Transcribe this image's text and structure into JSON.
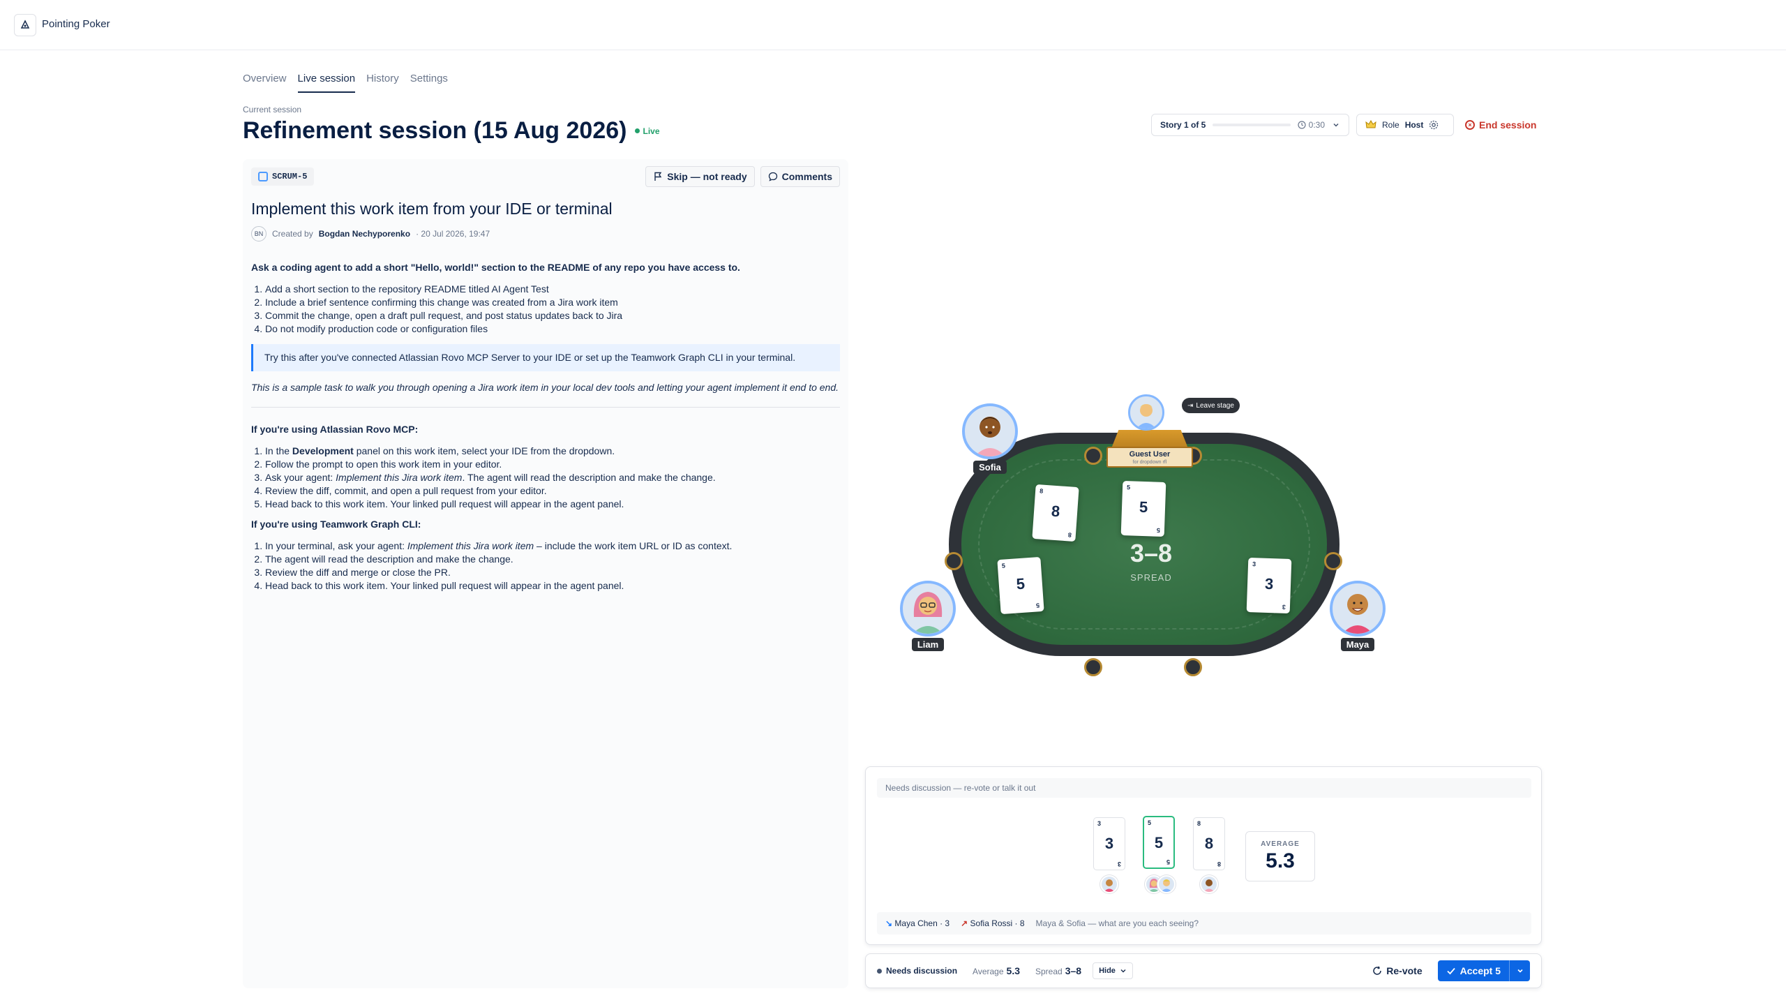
{
  "app": {
    "title": "Pointing Poker"
  },
  "tabs": [
    "Overview",
    "Live session",
    "History",
    "Settings"
  ],
  "session": {
    "label": "Current session",
    "title": "Refinement session (15 Aug 2026)",
    "status": "Live"
  },
  "header_controls": {
    "story": "Story 1 of 5",
    "timer": "0:30",
    "role_label": "Role",
    "role_value": "Host",
    "end_session": "End session"
  },
  "issue": {
    "key": "SCRUM-5",
    "skip_label": "Skip — not ready",
    "comments_label": "Comments",
    "title": "Implement this work item from your IDE or terminal",
    "author_initials": "BN",
    "created_prefix": "Created by",
    "author": "Bogdan Nechyporenko",
    "created_at": "· 20 Jul 2026, 19:47",
    "intro": "Ask a coding agent to add a short \"Hello, world!\" section to the README of any repo you have access to.",
    "steps": [
      "Add a short section to the repository README titled AI Agent Test",
      "Include a brief sentence confirming this change was created from a Jira work item",
      "Commit the change, open a draft pull request, and post status updates back to Jira",
      "Do not modify production code or configuration files"
    ],
    "info": "Try this after you've connected Atlassian Rovo MCP Server to your IDE or set up the Teamwork Graph CLI in your terminal.",
    "note": "This is a sample task to walk you through opening a Jira work item in your local dev tools and letting your agent implement it end to end.",
    "rovo_heading": "If you're using Atlassian Rovo MCP:",
    "rovo_step1_pre": "In the ",
    "rovo_step1_bold": "Development",
    "rovo_step1_post": " panel on this work item, select your IDE from the dropdown.",
    "rovo_step2": "Follow the prompt to open this work item in your editor.",
    "rovo_step3_pre": "Ask your agent: ",
    "rovo_step3_italic": "Implement this Jira work item",
    "rovo_step3_post": ". The agent will read the description and make the change.",
    "rovo_step4": "Review the diff, commit, and open a pull request from your editor.",
    "rovo_step5": "Head back to this work item. Your linked pull request will appear in the agent panel.",
    "cli_heading": "If you're using Teamwork Graph CLI:",
    "cli_step1_pre": "In your terminal, ask your agent: ",
    "cli_step1_italic": "Implement this Jira work item",
    "cli_step1_post": " – include the work item URL or ID as context.",
    "cli_step2": "The agent will read the description and make the change.",
    "cli_step3": "Review the diff and merge or close the PR.",
    "cli_step4": "Head back to this work item. Your linked pull request will appear in the agent panel."
  },
  "table": {
    "spread_value": "3–8",
    "spread_label": "SPREAD",
    "cards": [
      "8",
      "5",
      "5",
      "3"
    ],
    "players": [
      "Sofia",
      "Liam",
      "Maya"
    ],
    "guest_name": "Guest User",
    "guest_sub": "for dropdown rfl",
    "leave_stage": "Leave stage"
  },
  "results": {
    "header": "Needs discussion — re-vote or talk it out",
    "votes": [
      {
        "value": "3",
        "selected": false
      },
      {
        "value": "5",
        "selected": true
      },
      {
        "value": "8",
        "selected": false
      }
    ],
    "average_label": "AVERAGE",
    "average_value": "5.3",
    "low_outlier": "Maya Chen · 3",
    "high_outlier": "Sofia Rossi · 8",
    "hint": "Maya & Sofia — what are you each seeing?"
  },
  "bottom_bar": {
    "status": "Needs discussion",
    "average_label": "Average",
    "average_value": "5.3",
    "spread_label": "Spread",
    "spread_value": "3–8",
    "hide_label": "Hide",
    "revote_label": "Re-vote",
    "accept_label": "Accept 5"
  },
  "colors": {
    "primary": "#0c66e4",
    "live": "#22a06b",
    "danger": "#c9372c",
    "felt": "#2f6a3e"
  }
}
